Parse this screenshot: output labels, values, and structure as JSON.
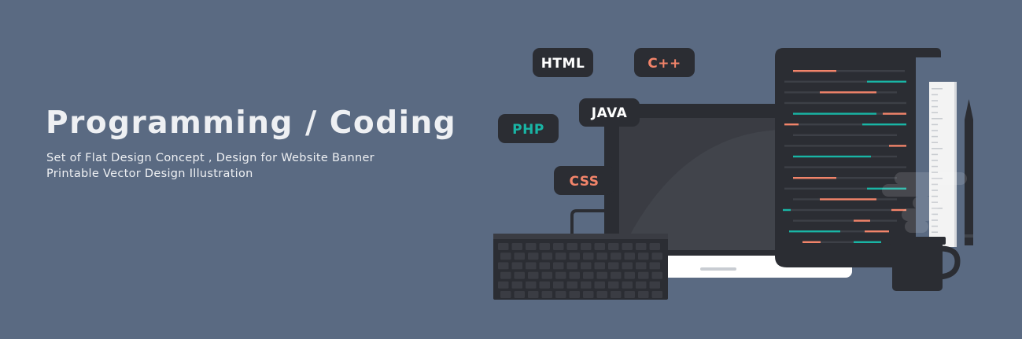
{
  "banner": {
    "title": "Programming / Coding",
    "subtitle_line1": "Set of Flat Design Concept , Design for Website Banner",
    "subtitle_line2": "Printable Vector Design Illustration"
  },
  "tags": [
    {
      "label": "HTML",
      "color": "#ffffff"
    },
    {
      "label": "C++",
      "color": "#f2846a"
    },
    {
      "label": "JAVA",
      "color": "#ffffff"
    },
    {
      "label": "PHP",
      "color": "#19b5a5"
    },
    {
      "label": "CSS",
      "color": "#f2846a"
    }
  ],
  "colors": {
    "background": "#5a6a82",
    "dark": "#2b2d33",
    "accent_orange": "#f2846a",
    "accent_teal": "#19b5a5",
    "code_gray": "#3d4047",
    "laptop_base": "#ffffff",
    "ruler": "#f3f3f3"
  },
  "icons": [
    "laptop-icon",
    "keyboard-icon",
    "code-document-icon",
    "ruler-icon",
    "pencil-icon",
    "coffee-mug-icon"
  ]
}
